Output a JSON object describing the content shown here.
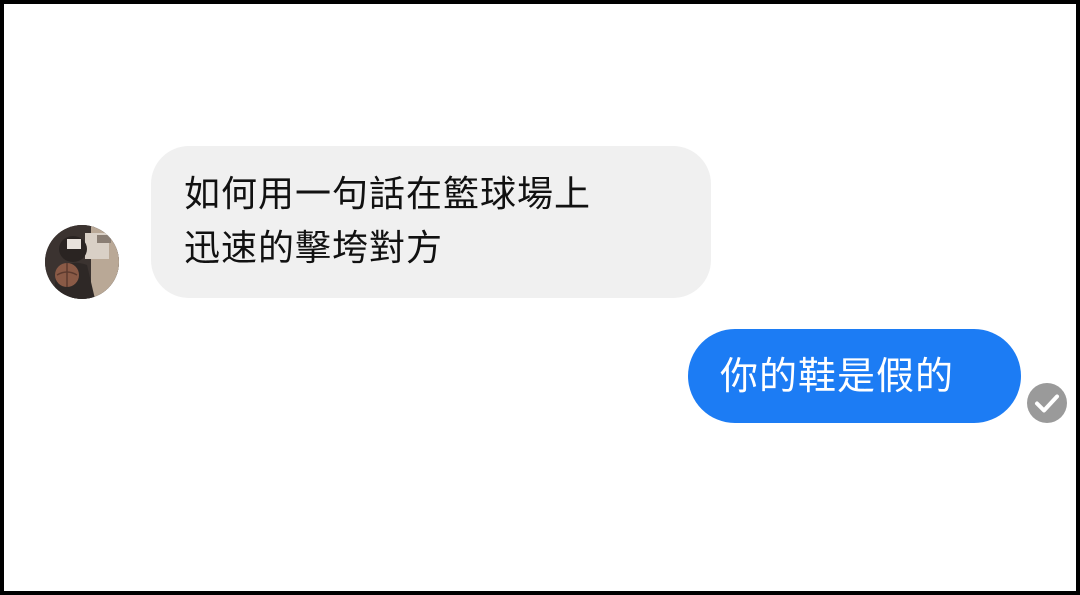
{
  "conversation": {
    "incoming": {
      "lines": [
        "如何用一句話在籃球場上",
        "迅速的擊垮對方"
      ]
    },
    "outgoing": {
      "text": "你的鞋是假的",
      "status_icon": "checkmark-circle-icon"
    }
  },
  "colors": {
    "incoming_bubble": "#f0f0f0",
    "outgoing_bubble": "#1c7cf4",
    "receipt": "#9a9a9a",
    "frame_border": "#000000"
  }
}
